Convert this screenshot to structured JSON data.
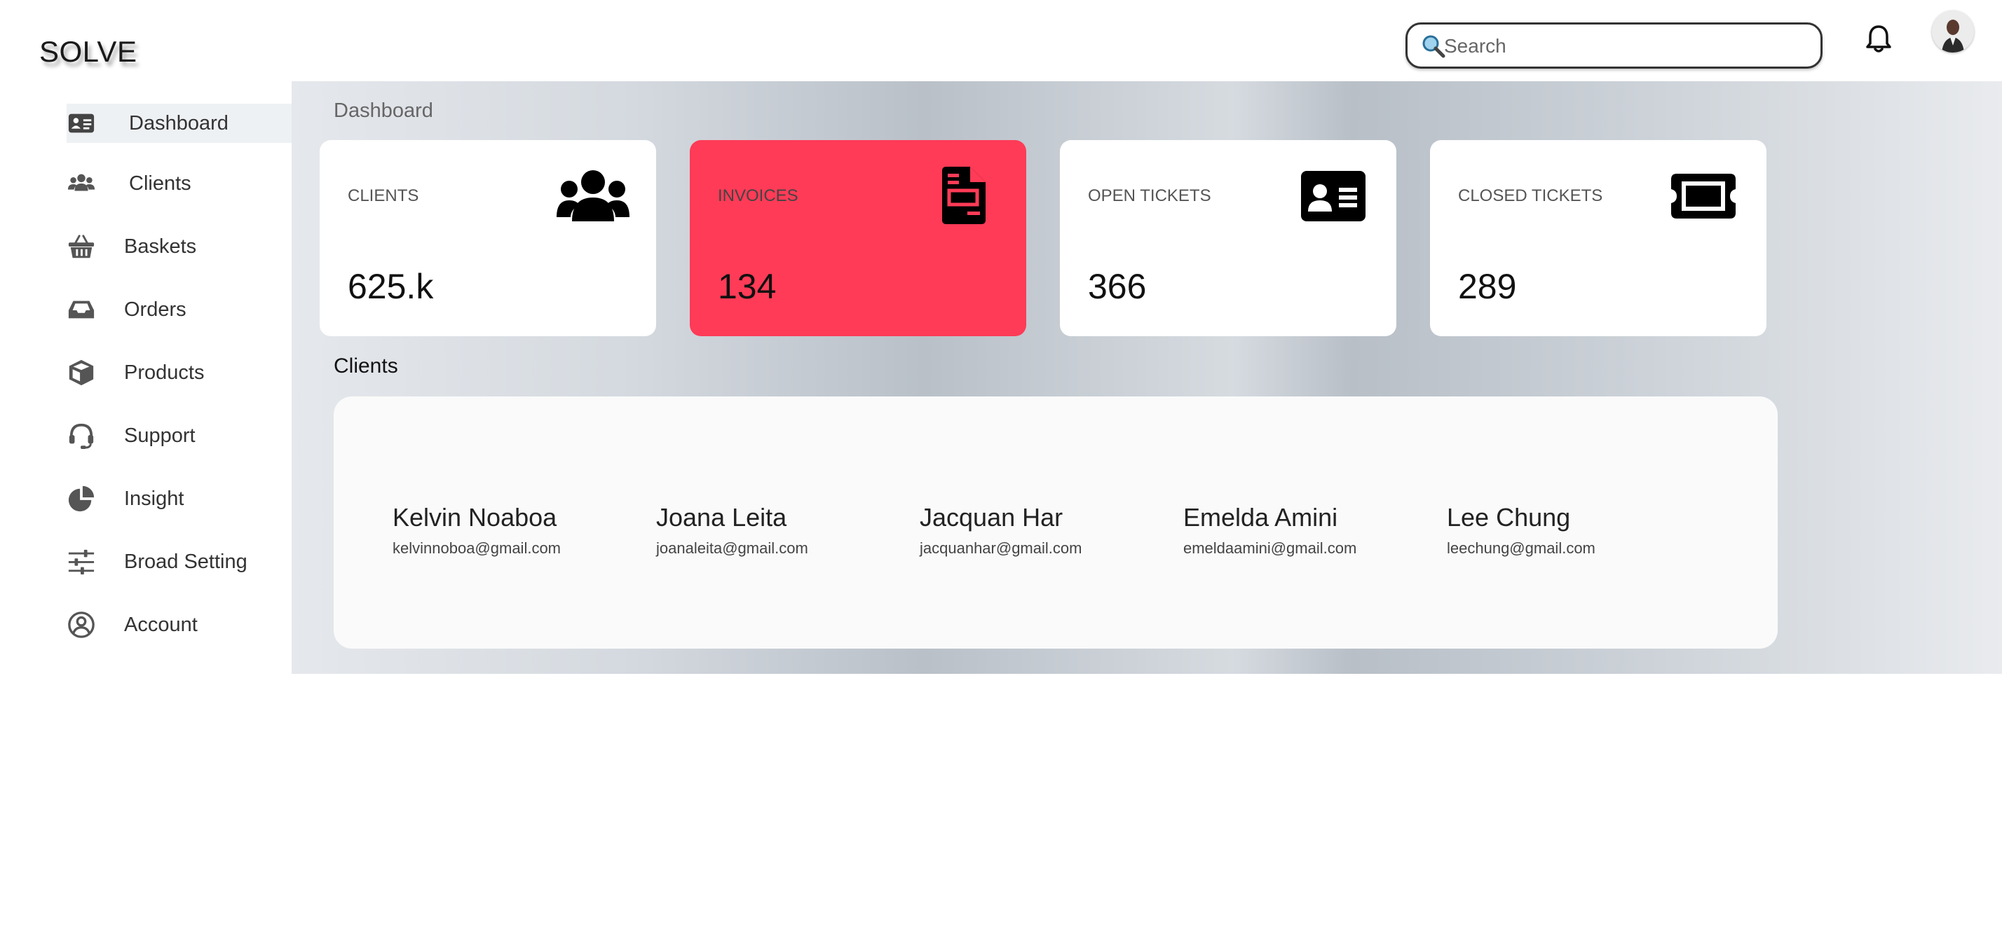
{
  "app": {
    "logo": "SOLVE"
  },
  "header": {
    "search_placeholder": "Search",
    "search_value": ""
  },
  "sidebar": {
    "items": [
      {
        "label": "Dashboard",
        "icon": "id-card-icon",
        "active": true
      },
      {
        "label": "Clients",
        "icon": "users-icon"
      },
      {
        "label": "Baskets",
        "icon": "basket-icon"
      },
      {
        "label": "Orders",
        "icon": "inbox-icon"
      },
      {
        "label": "Products",
        "icon": "box-icon"
      },
      {
        "label": "Support",
        "icon": "headset-icon"
      },
      {
        "label": "Insight",
        "icon": "pie-chart-icon"
      },
      {
        "label": "Broad Setting",
        "icon": "sliders-icon"
      },
      {
        "label": "Account",
        "icon": "user-circle-icon"
      }
    ]
  },
  "main": {
    "page_title": "Dashboard",
    "cards": [
      {
        "label": "CLIENTS",
        "value": "625.k",
        "icon": "users-icon",
        "bg": "#ffffff"
      },
      {
        "label": "INVOICES",
        "value": "134",
        "icon": "invoice-icon",
        "bg": "#ff3b57"
      },
      {
        "label": "OPEN TICKETS",
        "value": "366",
        "icon": "id-card-icon",
        "bg": "#ffffff"
      },
      {
        "label": "CLOSED TICKETS",
        "value": "289",
        "icon": "ticket-icon",
        "bg": "#ffffff"
      }
    ],
    "clients_title": "Clients",
    "clients": [
      {
        "name": "Kelvin Noaboa",
        "email": "kelvinnoboa@gmail.com"
      },
      {
        "name": "Joana Leita",
        "email": "joanaleita@gmail.com"
      },
      {
        "name": "Jacquan Har",
        "email": "jacquanhar@gmail.com"
      },
      {
        "name": "Emelda Amini",
        "email": "emeldaamini@gmail.com"
      },
      {
        "name": "Lee Chung",
        "email": "leechung@gmail.com"
      }
    ]
  },
  "colors": {
    "accent_red": "#ff3b57",
    "sidebar_active": "#eef1f4"
  }
}
